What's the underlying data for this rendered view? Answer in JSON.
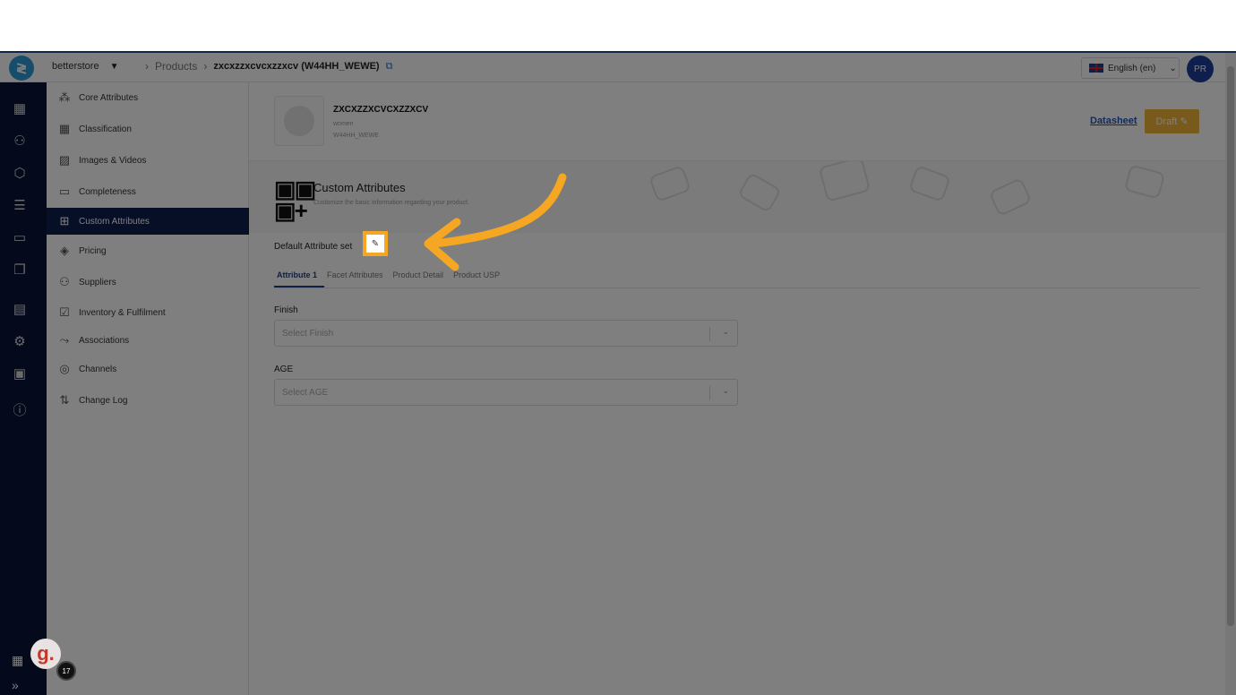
{
  "header": {
    "store": "betterstore",
    "breadcrumb": [
      "Products",
      "zxcxzzxcvcxzzxcv (W44HH_WEWE)"
    ],
    "language": "English (en)",
    "avatar": "PR"
  },
  "nav": {
    "items": [
      {
        "label": "Core Attributes",
        "icon": "network-icon"
      },
      {
        "label": "Classification",
        "icon": "grid-icon"
      },
      {
        "label": "Images & Videos",
        "icon": "image-icon"
      },
      {
        "label": "Completeness",
        "icon": "progress-icon"
      },
      {
        "label": "Custom Attributes",
        "icon": "grid-plus-icon",
        "active": true
      },
      {
        "label": "Pricing",
        "icon": "tag-icon"
      },
      {
        "label": "Suppliers",
        "icon": "users-icon"
      },
      {
        "label": "Inventory & Fulfilment",
        "icon": "inventory-icon"
      },
      {
        "label": "Associations",
        "icon": "link-icon"
      },
      {
        "label": "Channels",
        "icon": "channels-icon"
      },
      {
        "label": "Change Log",
        "icon": "sliders-icon"
      }
    ]
  },
  "product": {
    "name": "ZXCXZZXCVCXZZXCV",
    "category": "women",
    "sku": "W44HH_WEWE",
    "datasheet": "Datasheet",
    "status": "Draft"
  },
  "section": {
    "title": "Custom Attributes",
    "subtitle": "Customize the basic information regarding your product.",
    "default_set_label": "Default Attribute set"
  },
  "tabs": [
    "Attribute 1",
    "Facet Attributes",
    "Product Detail",
    "Product USP"
  ],
  "fields": [
    {
      "label": "Finish",
      "placeholder": "Select Finish"
    },
    {
      "label": "AGE",
      "placeholder": "Select AGE"
    }
  ],
  "widget": {
    "logo_letter": "g.",
    "count": "17"
  },
  "colors": {
    "accent": "#f5a623",
    "rail": "#081536",
    "active_nav": "#0f1f4f",
    "brand_blue": "#1d3f8f"
  }
}
